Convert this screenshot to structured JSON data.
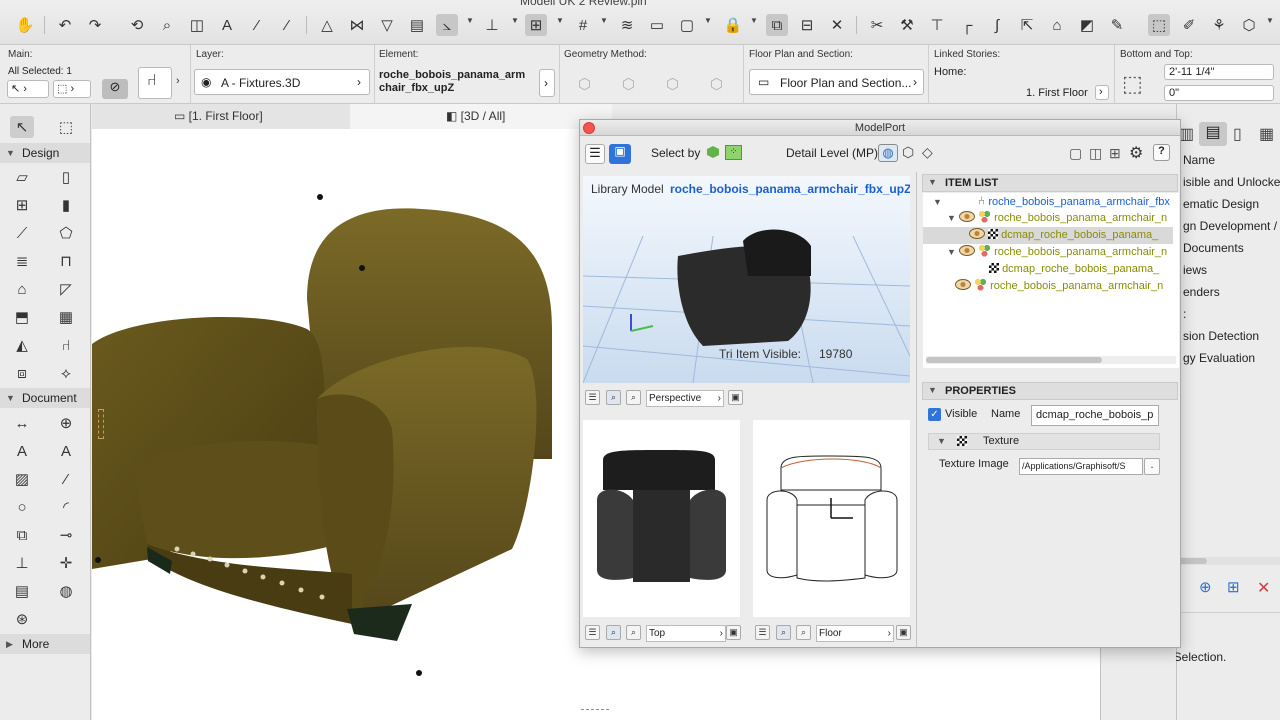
{
  "window": {
    "title": "Modell UK 2 Review.pln"
  },
  "infobox": {
    "main_label": "Main:",
    "all_selected": "All Selected: 1",
    "layer_label": "Layer:",
    "layer_value": "A - Fixtures.3D",
    "element_label": "Element:",
    "element_value_line1": "roche_bobois_panama_arm",
    "element_value_line2": "chair_fbx_upZ",
    "geometry_label": "Geometry Method:",
    "floorplan_label": "Floor Plan and Section:",
    "floorplan_value": "Floor Plan and Section...",
    "linked_label": "Linked Stories:",
    "home_label": "Home:",
    "home_value": "1. First Floor",
    "bt_label": "Bottom and Top:",
    "top_value": "2'-11 1/4\"",
    "bottom_value": "0\""
  },
  "tabs": [
    {
      "label": "[1. First Floor]"
    },
    {
      "label": "[3D / All]"
    }
  ],
  "toolbox": {
    "design_label": "Design",
    "document_label": "Document",
    "more_label": "More"
  },
  "modelport": {
    "title": "ModelPort",
    "select_by": "Select by",
    "detail_level": "Detail Level (MP)",
    "library_model_label": "Library Model",
    "library_model_name": "roche_bobois_panama_armchair_fbx_upZ",
    "tri_visible_label": "Tri Item Visible:",
    "tri_visible_value": "19780",
    "view_perspective": "Perspective",
    "view_top": "Top",
    "view_floor": "Floor",
    "item_list_header": "ITEM LIST",
    "items": [
      {
        "label": "roche_bobois_panama_armchair_fbx",
        "color": "#1a5fd0"
      },
      {
        "label": "roche_bobois_panama_armchair_n",
        "color": "#8a8d00"
      },
      {
        "label": "dcmap_roche_bobois_panama_",
        "color": "#8a8d00"
      },
      {
        "label": "roche_bobois_panama_armchair_n",
        "color": "#8a8d00"
      },
      {
        "label": "dcmap_roche_bobois_panama_",
        "color": "#8a8d00"
      },
      {
        "label": "roche_bobois_panama_armchair_n",
        "color": "#8a8d00"
      }
    ],
    "properties_header": "PROPERTIES",
    "visible_label": "Visible",
    "name_label": "Name",
    "name_value": "dcmap_roche_bobois_p",
    "texture_label": "Texture",
    "texture_image_label": "Texture Image",
    "texture_image_value": "/Applications/Graphisoft/S"
  },
  "navigator": {
    "lines": [
      "Name",
      "isible and Unlocked",
      "ematic Design",
      "gn Development / C",
      "Documents",
      "iews",
      "enders",
      ":",
      "sion Detection",
      "gy Evaluation"
    ],
    "no_selection": "No Selection."
  }
}
